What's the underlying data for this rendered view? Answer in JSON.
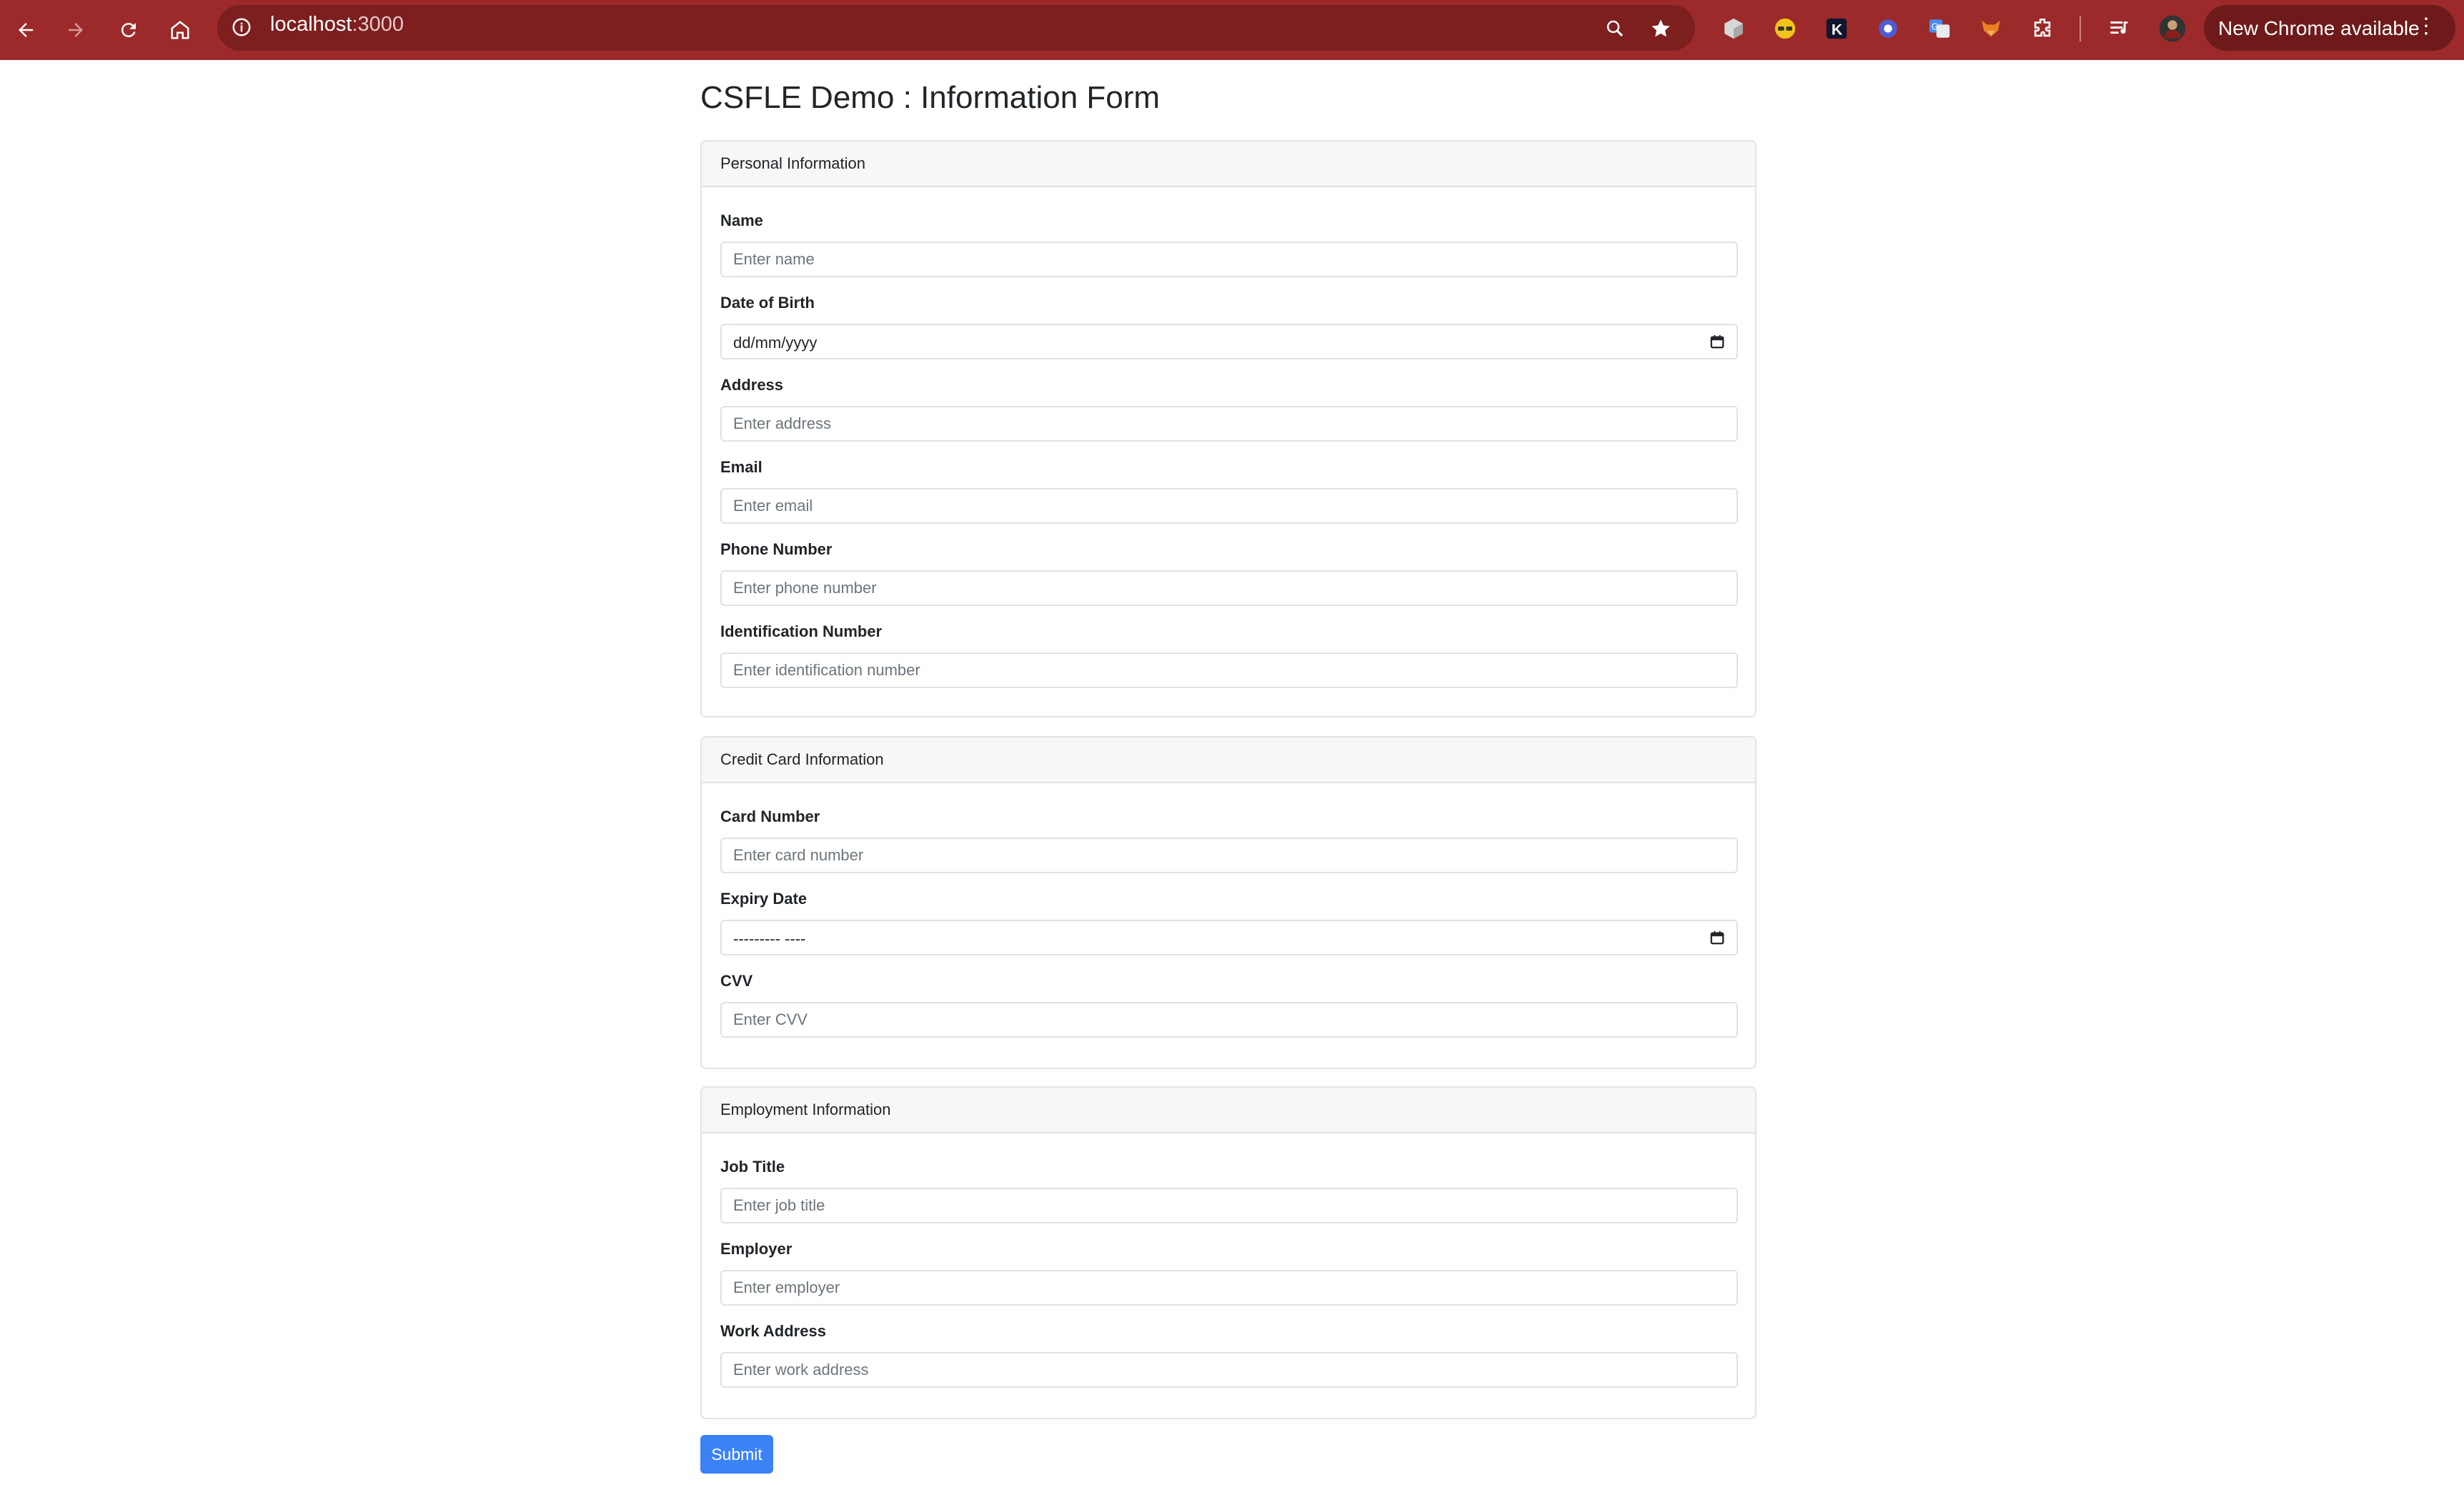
{
  "browser": {
    "url_host": "localhost",
    "url_port": ":3000",
    "update_label": "New Chrome available",
    "colors": {
      "toolbar": "#9c2a2a",
      "omnibox": "#7d1f1f"
    }
  },
  "page": {
    "title": "CSFLE Demo : Information Form",
    "submit_label": "Submit",
    "accent_color": "#3b82f6"
  },
  "personal": {
    "header": "Personal Information",
    "name": {
      "label": "Name",
      "placeholder": "Enter name"
    },
    "dob": {
      "label": "Date of Birth",
      "value": "dd/mm/yyyy"
    },
    "address": {
      "label": "Address",
      "placeholder": "Enter address"
    },
    "email": {
      "label": "Email",
      "placeholder": "Enter email"
    },
    "phone": {
      "label": "Phone Number",
      "placeholder": "Enter phone number"
    },
    "id_number": {
      "label": "Identification Number",
      "placeholder": "Enter identification number"
    }
  },
  "credit": {
    "header": "Credit Card Information",
    "card_number": {
      "label": "Card Number",
      "placeholder": "Enter card number"
    },
    "expiry": {
      "label": "Expiry Date",
      "value": "--------- ----"
    },
    "cvv": {
      "label": "CVV",
      "placeholder": "Enter CVV"
    }
  },
  "employment": {
    "header": "Employment Information",
    "job_title": {
      "label": "Job Title",
      "placeholder": "Enter job title"
    },
    "employer": {
      "label": "Employer",
      "placeholder": "Enter employer"
    },
    "work_address": {
      "label": "Work Address",
      "placeholder": "Enter work address"
    }
  }
}
